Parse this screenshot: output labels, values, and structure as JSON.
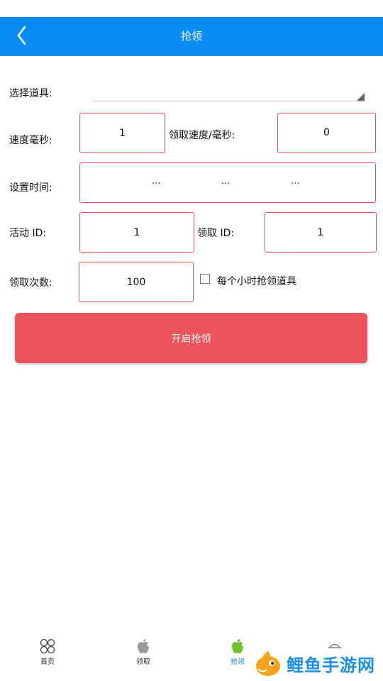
{
  "header": {
    "title": "抢领"
  },
  "form": {
    "select_item_label": "选择道具:",
    "select_item_value": "",
    "speed_ms_label": "速度毫秒:",
    "speed_ms_value": "1",
    "claim_speed_ms_label": "领取速度/毫秒:",
    "claim_speed_ms_value": "0",
    "set_time_label": "设置时间:",
    "time_fields": [
      "...",
      "...",
      "..."
    ],
    "activity_id_label": "活动 ID:",
    "activity_id_value": "1",
    "claim_id_label": "领取 ID:",
    "claim_id_value": "1",
    "claim_count_label": "领取次数:",
    "claim_count_value": "100",
    "hourly_checkbox_label": "每个小时抢领道具",
    "hourly_checkbox_checked": false
  },
  "start_button": {
    "label": "开启抢领"
  },
  "tabbar": {
    "tabs": [
      {
        "label": "首页",
        "icon": "grid-icon",
        "active": false
      },
      {
        "label": "领取",
        "icon": "apple-icon",
        "active": false
      },
      {
        "label": "抢领",
        "icon": "green-apple-icon",
        "active": true
      },
      {
        "label": "",
        "icon": "hat-icon",
        "active": false
      }
    ]
  },
  "watermark": {
    "text": "鲤鱼手游网",
    "icon": "fish-logo-icon"
  },
  "colors": {
    "header": "#0a8cf5",
    "accent_red": "#ee525a",
    "border_red": "#e8505b",
    "active_tab": "#1a8fe8"
  }
}
